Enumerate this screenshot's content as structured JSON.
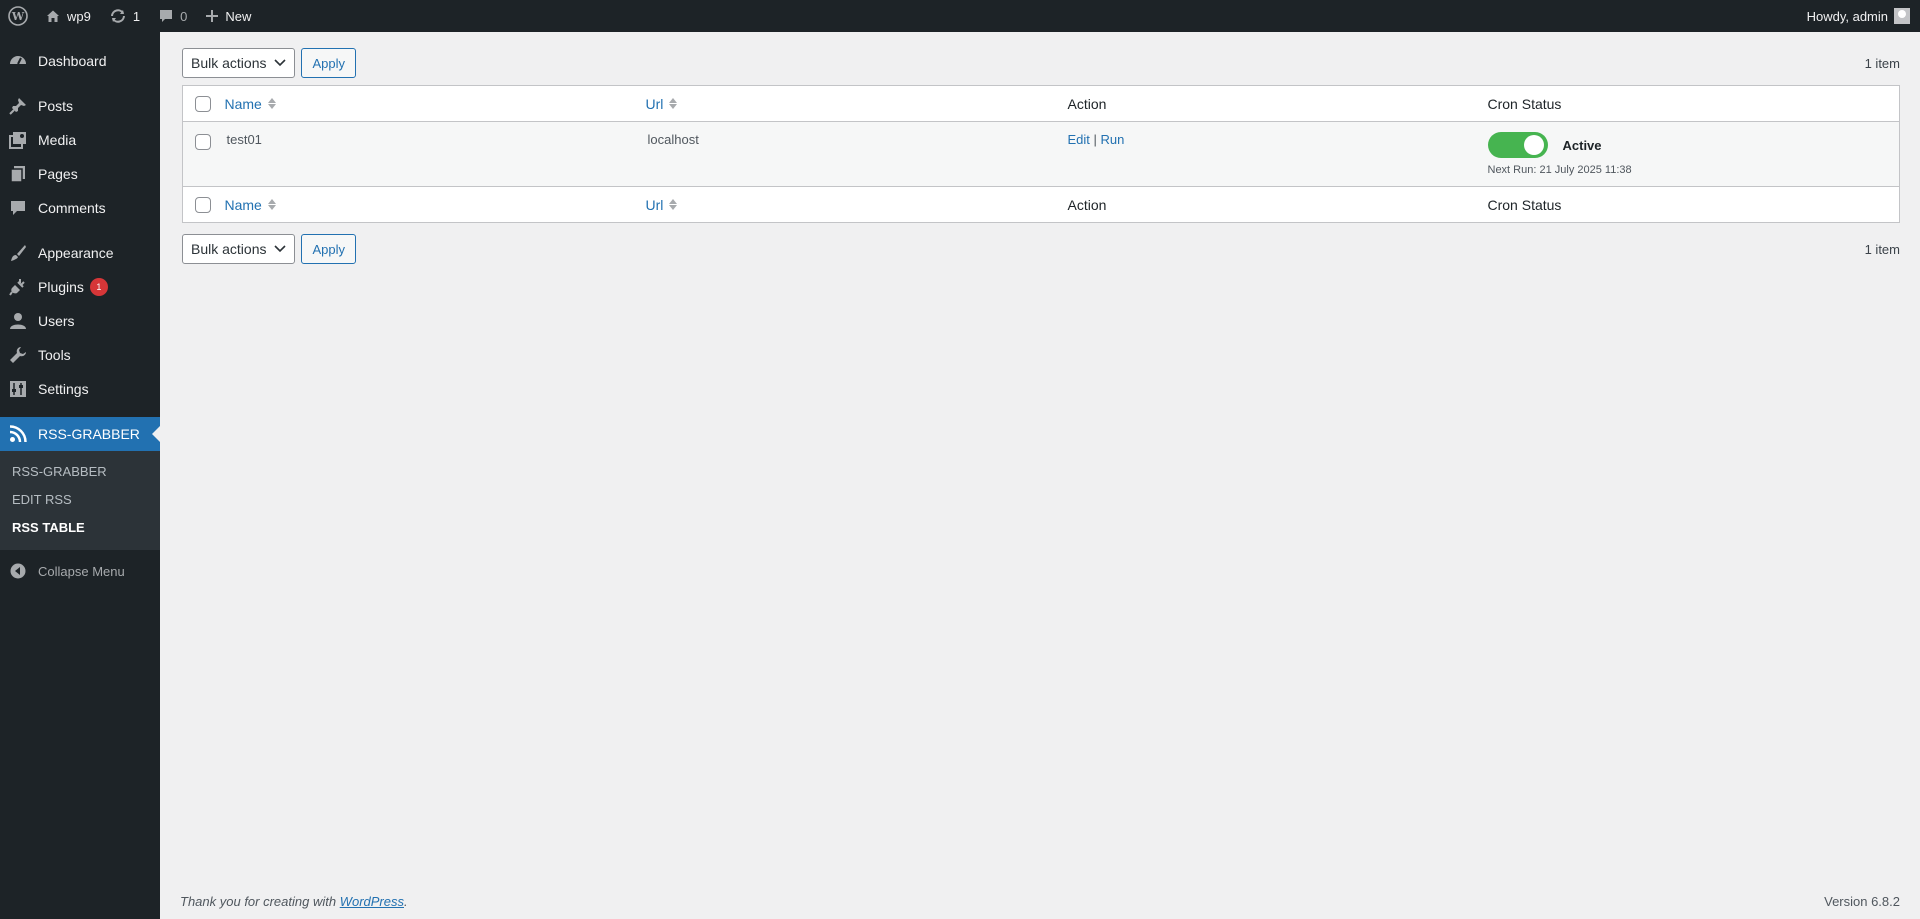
{
  "adminbar": {
    "site_name": "wp9",
    "updates_count": "1",
    "comments_count": "0",
    "new_label": "New",
    "howdy": "Howdy, admin"
  },
  "sidebar": {
    "dashboard": "Dashboard",
    "posts": "Posts",
    "media": "Media",
    "pages": "Pages",
    "comments": "Comments",
    "appearance": "Appearance",
    "plugins": "Plugins",
    "plugins_badge": "1",
    "users": "Users",
    "tools": "Tools",
    "settings": "Settings",
    "rss_grabber": "RSS-GRABBER",
    "submenu": {
      "rss_grabber": "RSS-GRABBER",
      "edit_rss": "EDIT RSS",
      "rss_table": "RSS TABLE"
    },
    "collapse": "Collapse Menu"
  },
  "tablenav": {
    "bulk_actions": "Bulk actions",
    "apply": "Apply",
    "count": "1 item"
  },
  "table": {
    "headers": {
      "name": "Name",
      "url": "Url",
      "action": "Action",
      "cron_status": "Cron Status"
    },
    "rows": [
      {
        "name": "test01",
        "url": "localhost",
        "edit": "Edit",
        "separator": "|",
        "run": "Run",
        "cron_state": "Active",
        "next_run": "Next Run: 21 July 2025 11:38"
      }
    ]
  },
  "footer": {
    "thanks_prefix": "Thank you for creating with ",
    "wordpress_link": "WordPress",
    "thanks_suffix": ".",
    "version": "Version 6.8.2"
  },
  "colors": {
    "accent": "#2271b1",
    "toggle_active": "#46b450",
    "admin_dark": "#1d2327",
    "badge": "#d63638"
  }
}
